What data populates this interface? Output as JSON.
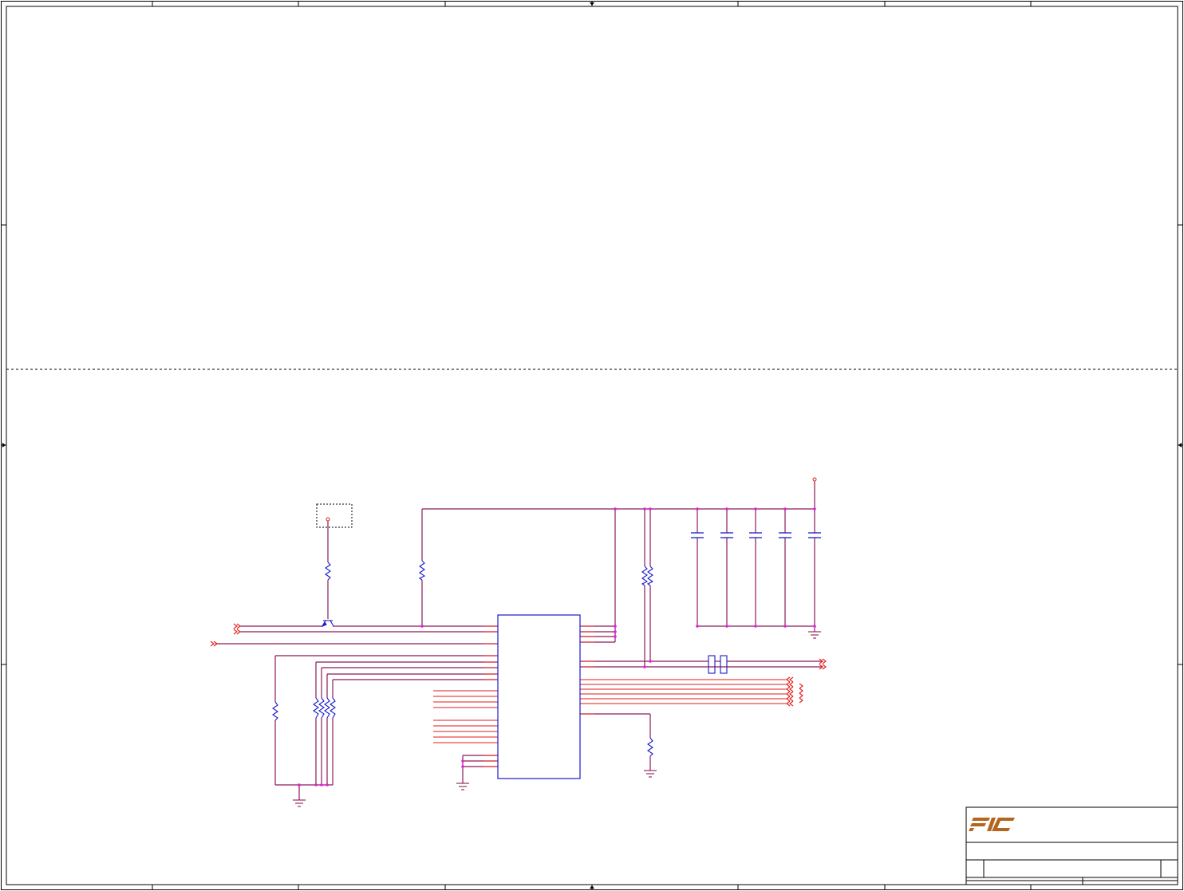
{
  "colors": {
    "paper": "#ffffff",
    "frame": "#000000",
    "wire": "#8b1a5a",
    "pin": "#e31b1b",
    "part": "#1a1acc",
    "junction": "#e020e0",
    "logo": "#b5651d"
  },
  "title_block": {
    "logo": "FIC"
  }
}
